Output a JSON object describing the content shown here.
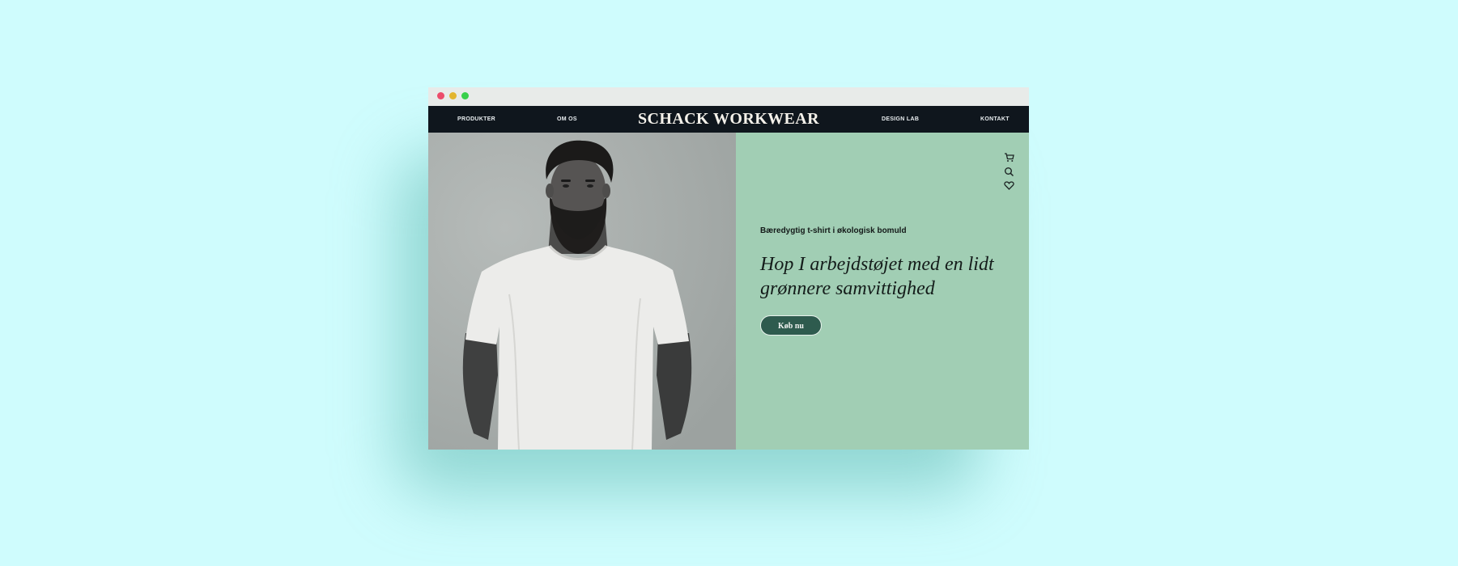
{
  "browser": {
    "traffic_lights": [
      "#ec4c6b",
      "#e2b52f",
      "#38d04b"
    ]
  },
  "nav": {
    "items": [
      {
        "label": "PRODUKTER"
      },
      {
        "label": "OM OS"
      },
      {
        "label": "DESIGN LAB"
      },
      {
        "label": "KONTAKT"
      }
    ],
    "brand": "SCHACK WORKWEAR"
  },
  "hero": {
    "subtitle": "Bæredygtig t-shirt i økologisk bomuld",
    "headline": "Hop I arbejdstøjet med en lidt grønnere samvittighed",
    "cta_label": "Køb nu"
  },
  "icons": [
    "cart-icon",
    "search-icon",
    "heart-icon"
  ],
  "colors": {
    "page_bg": "#cffcfd",
    "nav_bg": "#0f161d",
    "panel_bg": "#a1ceb4",
    "cta_bg": "#2e5b4e"
  }
}
